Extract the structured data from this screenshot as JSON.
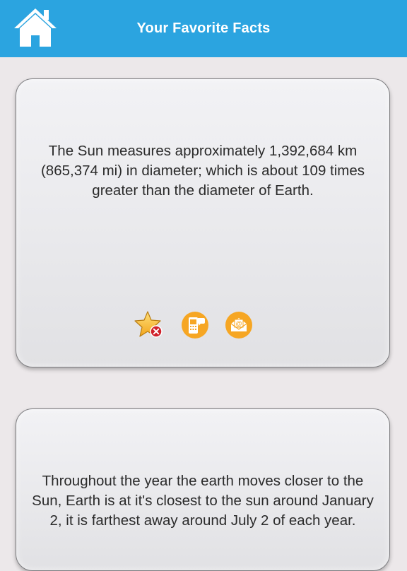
{
  "header": {
    "title": "Your Favorite Facts",
    "color": "#2ba4e0",
    "home_icon": "home-icon"
  },
  "facts": [
    {
      "text": "The Sun measures approximately 1,392,684 km (865,374 mi) in diameter; which is about 109 times greater than the diameter of Earth.",
      "actions": [
        "unfavorite-star-icon",
        "sms-phone-icon",
        "email-envelope-icon"
      ]
    },
    {
      "text": "Throughout the year the earth moves closer to the Sun, Earth is at it's closest to the sun around January 2, it is farthest away around July 2 of each year."
    }
  ],
  "colors": {
    "accent_orange": "#f6a623",
    "remove_red": "#d0212b"
  }
}
